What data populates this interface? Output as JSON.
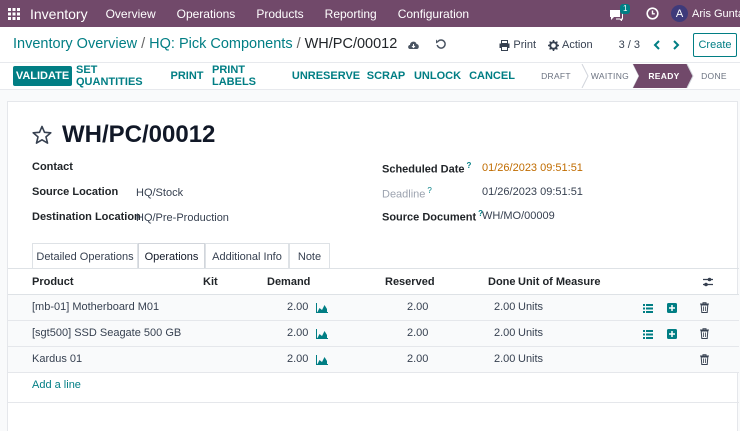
{
  "navbar": {
    "brand": "Inventory",
    "menu": [
      "Overview",
      "Operations",
      "Products",
      "Reporting",
      "Configuration"
    ],
    "chat_count": "1",
    "avatar_letter": "A",
    "user_name": "Aris Guntar"
  },
  "control": {
    "breadcrumb": [
      "Inventory Overview",
      "HQ: Pick Components",
      "WH/PC/00012"
    ],
    "print_label": "Print",
    "action_label": "Action",
    "pager": "3 / 3",
    "create_label": "Create"
  },
  "actions": {
    "validate": "VALIDATE",
    "set_quantities": "SET QUANTITIES",
    "print": "PRINT",
    "print_labels": "PRINT LABELS",
    "unreserve": "UNRESERVE",
    "scrap": "SCRAP",
    "unlock": "UNLOCK",
    "cancel": "CANCEL"
  },
  "statusbar": {
    "stages": [
      "DRAFT",
      "WAITING",
      "READY",
      "DONE"
    ],
    "active": "READY",
    "active_color": "#71496a"
  },
  "record": {
    "name": "WH/PC/00012",
    "contact_label": "Contact",
    "contact_value": "",
    "source_location_label": "Source Location",
    "source_location_value": "HQ/Stock",
    "destination_location_label": "Destination Location",
    "destination_location_value": "HQ/Pre-Production",
    "scheduled_date_label": "Scheduled Date",
    "scheduled_date_value": "01/26/2023 09:51:51",
    "deadline_label": "Deadline",
    "deadline_value": "01/26/2023 09:51:51",
    "source_document_label": "Source Document",
    "source_document_value": "WH/MO/00009",
    "help_mark": "?"
  },
  "tabs": [
    "Detailed Operations",
    "Operations",
    "Additional Info",
    "Note"
  ],
  "active_tab": "Operations",
  "grid": {
    "headers": {
      "product": "Product",
      "kit": "Kit",
      "demand": "Demand",
      "reserved": "Reserved",
      "done": "Done",
      "uom": "Unit of Measure"
    },
    "rows": [
      {
        "product": "[mb-01] Motherboard M01",
        "demand": "2.00",
        "reserved": "2.00",
        "done": "2.00",
        "uom": "Units"
      },
      {
        "product": "[sgt500] SSD Seagate 500 GB",
        "demand": "2.00",
        "reserved": "2.00",
        "done": "2.00",
        "uom": "Units"
      },
      {
        "product": "Kardus 01",
        "demand": "2.00",
        "reserved": "2.00",
        "done": "2.00",
        "uom": "Units"
      }
    ],
    "add_line": "Add a line"
  },
  "colors": {
    "navbar": "#71496a",
    "accent": "#017e84",
    "date_highlight": "#c06c00"
  }
}
